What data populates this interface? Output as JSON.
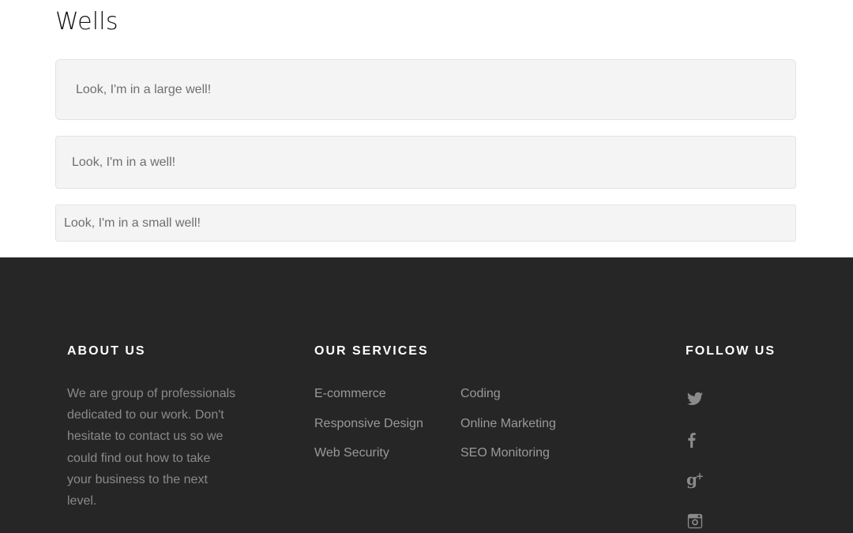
{
  "page": {
    "title": "Wells"
  },
  "wells": {
    "large": "Look, I'm in a large well!",
    "default": "Look, I'm in a well!",
    "small": "Look, I'm in a small well!"
  },
  "footer": {
    "about": {
      "heading": "ABOUT US",
      "text": "We are group of professionals dedicated to our work. Don't hesitate to contact us so we could find out how to take your business to the next level."
    },
    "services": {
      "heading": "OUR SERVICES",
      "column1": [
        "E-commerce",
        "Responsive Design",
        "Web Security"
      ],
      "column2": [
        "Coding",
        "Online Marketing",
        "SEO Monitoring"
      ]
    },
    "follow": {
      "heading": "FOLLOW US",
      "icons": [
        "twitter-icon",
        "facebook-icon",
        "google-plus-icon",
        "instagram-icon"
      ]
    }
  },
  "colors": {
    "footer_bg": "#262626",
    "well_bg": "#f4f4f4",
    "footer_link": "#999999",
    "heading_white": "#ffffff"
  }
}
